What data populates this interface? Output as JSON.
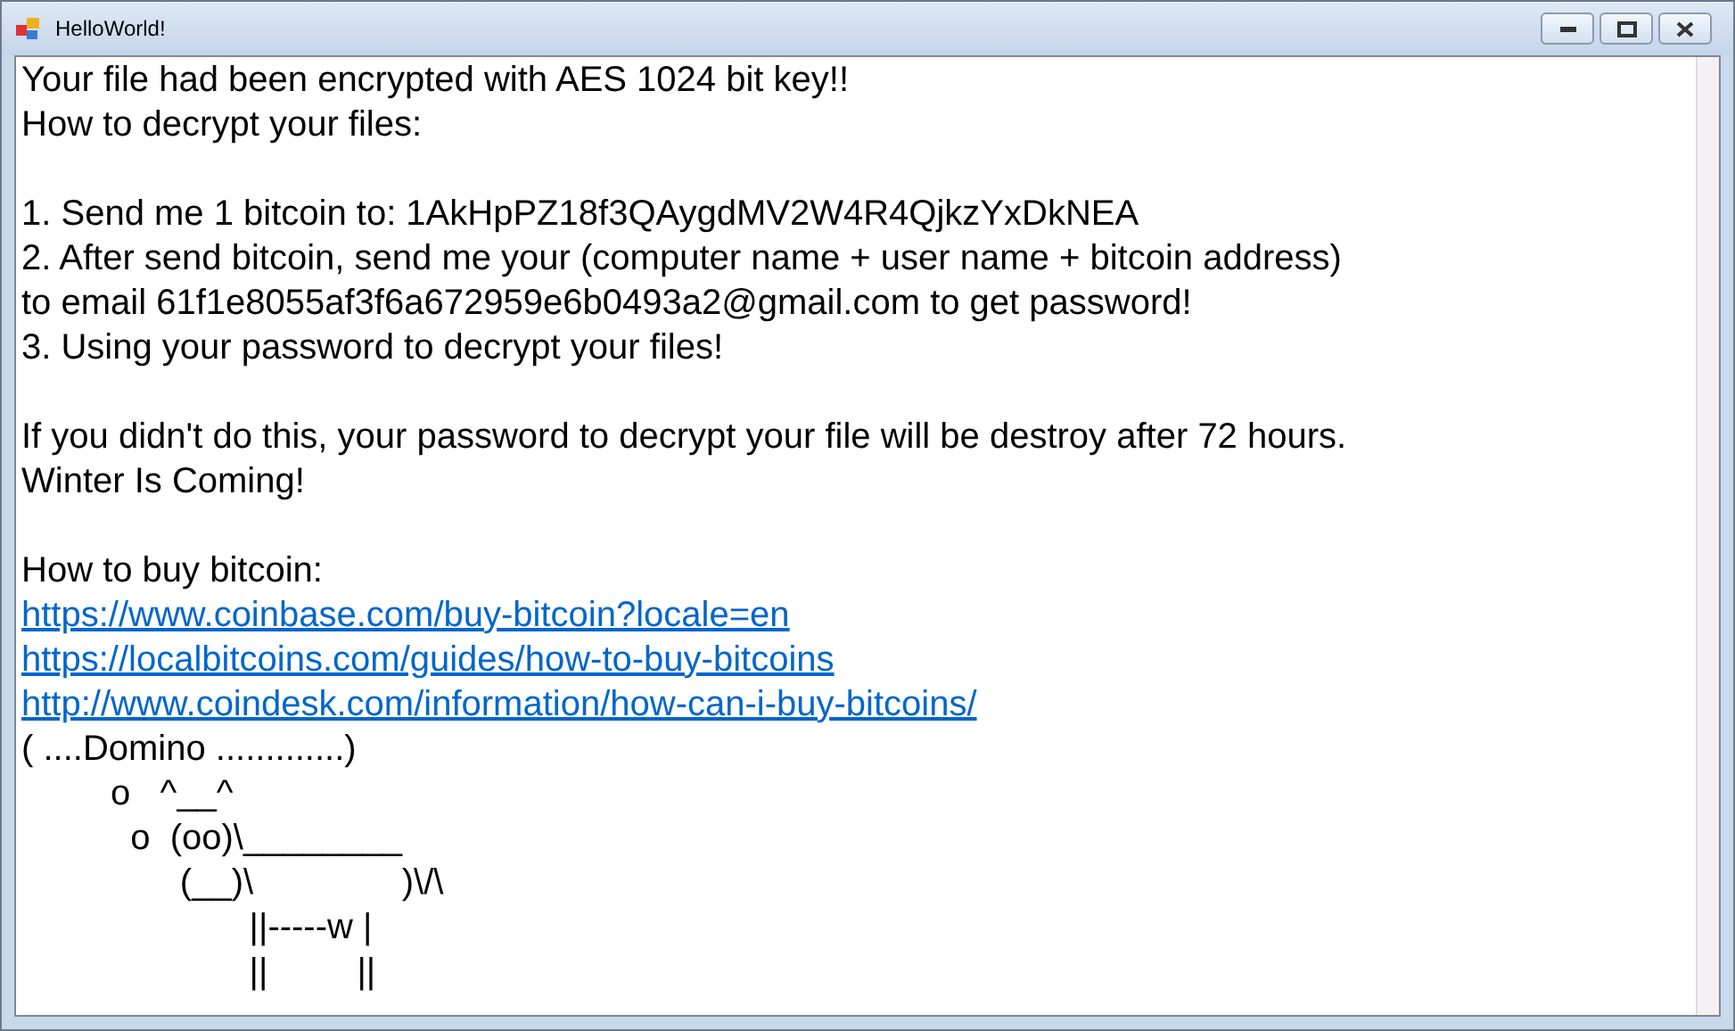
{
  "window": {
    "title": "HelloWorld!"
  },
  "blocks": [
    {
      "lines": [
        {
          "kind": "text",
          "text": "Your file had been encrypted with AES 1024 bit key!!"
        },
        {
          "kind": "text",
          "text": "How to decrypt your files:"
        }
      ]
    },
    {
      "lines": [
        {
          "kind": "text",
          "text": "1. Send me 1 bitcoin to: 1AkHpPZ18f3QAygdMV2W4R4QjkzYxDkNEA"
        },
        {
          "kind": "text",
          "text": "2. After send bitcoin, send me your (computer name + user name + bitcoin address)"
        },
        {
          "kind": "text",
          "text": "to email 61f1e8055af3f6a672959e6b0493a2@gmail.com to get password!"
        },
        {
          "kind": "text",
          "text": "3. Using your password to decrypt your files!"
        }
      ]
    },
    {
      "lines": [
        {
          "kind": "text",
          "text": "If you didn't do this, your password to decrypt your file will be destroy after 72 hours."
        },
        {
          "kind": "text",
          "text": "Winter Is Coming!"
        }
      ]
    },
    {
      "lines": [
        {
          "kind": "text",
          "text": "How to buy bitcoin:"
        },
        {
          "kind": "link",
          "text": "https://www.coinbase.com/buy-bitcoin?locale=en"
        },
        {
          "kind": "link",
          "text": "https://localbitcoins.com/guides/how-to-buy-bitcoins"
        },
        {
          "kind": "link",
          "text": "http://www.coindesk.com/information/how-can-i-buy-bitcoins/"
        },
        {
          "kind": "text",
          "text": "( ....Domino .............)"
        },
        {
          "kind": "art",
          "text": "         o   ^__^"
        },
        {
          "kind": "art",
          "text": "           o  (oo)\\________"
        },
        {
          "kind": "art",
          "text": "                (__)\\               )\\/\\"
        },
        {
          "kind": "art",
          "text": "                       ||-----w |"
        },
        {
          "kind": "art",
          "text": "                       ||         ||"
        }
      ]
    }
  ]
}
